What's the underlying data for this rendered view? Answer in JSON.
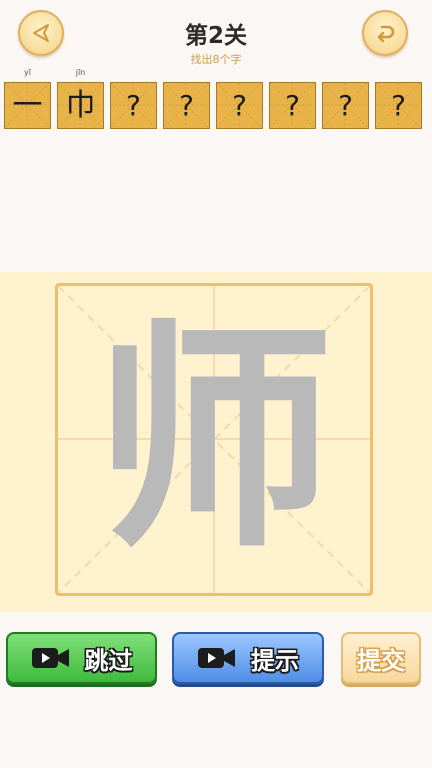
{
  "header": {
    "title": "第2关",
    "subtitle": "找出8个字"
  },
  "slots": [
    {
      "char": "一",
      "pinyin": "yī",
      "found": true
    },
    {
      "char": "巾",
      "pinyin": "jīn",
      "found": true
    },
    {
      "char": "?",
      "pinyin": "",
      "found": false
    },
    {
      "char": "?",
      "pinyin": "",
      "found": false
    },
    {
      "char": "?",
      "pinyin": "",
      "found": false
    },
    {
      "char": "?",
      "pinyin": "",
      "found": false
    },
    {
      "char": "?",
      "pinyin": "",
      "found": false
    },
    {
      "char": "?",
      "pinyin": "",
      "found": false
    }
  ],
  "board": {
    "character": "师"
  },
  "actions": {
    "skip_label": "跳过",
    "hint_label": "提示",
    "submit_label": "提交"
  },
  "icons": {
    "back": "back-arrow-icon",
    "restart": "restart-icon",
    "video": "video-camera-icon"
  },
  "colors": {
    "slot_bg": "#e8b44a",
    "board_bg": "#fff2cf",
    "board_border": "#f0be6a",
    "skip_green": "#3fba3c",
    "hint_blue": "#4f8de6",
    "submit_cream": "#f7d79e"
  }
}
